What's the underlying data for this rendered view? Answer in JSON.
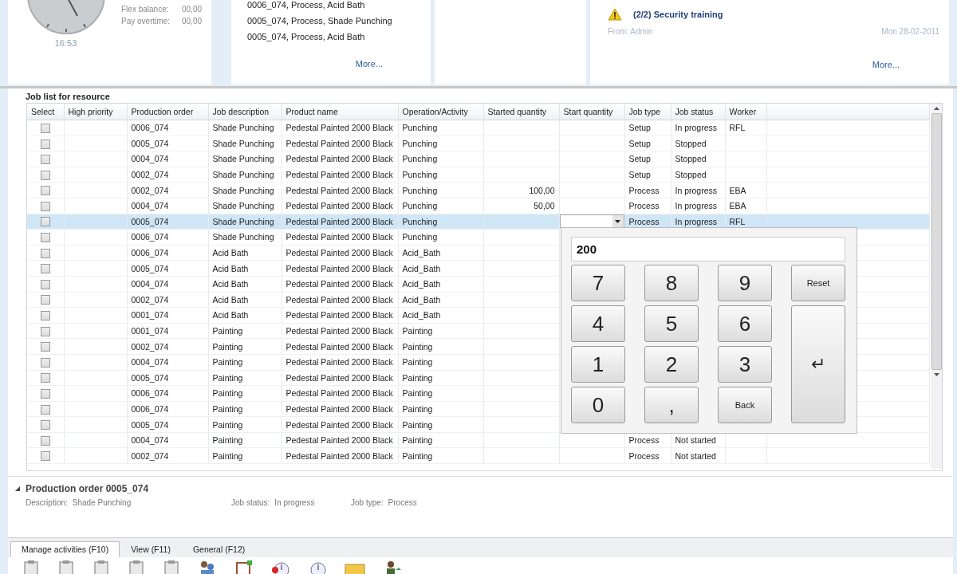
{
  "clock_panel": {
    "time": "16:53",
    "fields": [
      {
        "label": "Flex balance:",
        "value": "00,00"
      },
      {
        "label": "Pay overtime:",
        "value": "00,00"
      }
    ]
  },
  "recent_jobs": {
    "items": [
      "0006_074, Process, Acid Bath",
      "0005_074, Process, Shade Punching",
      "0005_074, Process, Acid Bath"
    ],
    "more": "More..."
  },
  "messages": {
    "items": [
      {
        "title": "(2/2) Security training",
        "from": "From: Admin",
        "date": "Mon 28-02-2011"
      }
    ],
    "more": "More..."
  },
  "job_list": {
    "title": "Job list for resource",
    "columns": [
      "Select",
      "High priority",
      "Production order",
      "Job description",
      "Product name",
      "Operation/Activity",
      "Started quantity",
      "Start quantity",
      "Job type",
      "Job status",
      "Worker"
    ],
    "rows": [
      {
        "selected": false,
        "checked": false,
        "editing": false,
        "order": "0006_074",
        "description": "Shade Punching",
        "product": "Pedestal Painted 2000 Black",
        "operation": "Punching",
        "job_type": "Setup",
        "job_status": "In progress",
        "worker": "RFL"
      },
      {
        "selected": false,
        "checked": false,
        "editing": false,
        "order": "0005_074",
        "description": "Shade Punching",
        "product": "Pedestal Painted 2000 Black",
        "operation": "Punching",
        "job_type": "Setup",
        "job_status": "Stopped"
      },
      {
        "selected": false,
        "checked": false,
        "editing": false,
        "order": "0004_074",
        "description": "Shade Punching",
        "product": "Pedestal Painted 2000 Black",
        "operation": "Punching",
        "job_type": "Setup",
        "job_status": "Stopped"
      },
      {
        "selected": false,
        "checked": false,
        "editing": false,
        "order": "0002_074",
        "description": "Shade Punching",
        "product": "Pedestal Painted 2000 Black",
        "operation": "Punching",
        "job_type": "Setup",
        "job_status": "Stopped"
      },
      {
        "selected": false,
        "checked": false,
        "editing": false,
        "order": "0002_074",
        "description": "Shade Punching",
        "product": "Pedestal Painted 2000 Black",
        "operation": "Punching",
        "started_qty": "100,00",
        "job_type": "Process",
        "job_status": "In progress",
        "worker": "EBA"
      },
      {
        "selected": false,
        "checked": false,
        "editing": false,
        "order": "0004_074",
        "description": "Shade Punching",
        "product": "Pedestal Painted 2000 Black",
        "operation": "Punching",
        "started_qty": "50,00",
        "job_type": "Process",
        "job_status": "In progress",
        "worker": "EBA"
      },
      {
        "selected": true,
        "checked": false,
        "editing": true,
        "order": "0005_074",
        "description": "Shade Punching",
        "product": "Pedestal Painted 2000 Black",
        "operation": "Punching",
        "job_type": "Process",
        "job_status": "In progress",
        "worker": "RFL"
      },
      {
        "selected": false,
        "checked": false,
        "editing": false,
        "order": "0006_074",
        "description": "Shade Punching",
        "product": "Pedestal Painted 2000 Black",
        "operation": "Punching"
      },
      {
        "selected": false,
        "checked": false,
        "editing": false,
        "order": "0006_074",
        "description": "Acid Bath",
        "product": "Pedestal Painted 2000 Black",
        "operation": "Acid_Bath"
      },
      {
        "selected": false,
        "checked": false,
        "editing": false,
        "order": "0005_074",
        "description": "Acid Bath",
        "product": "Pedestal Painted 2000 Black",
        "operation": "Acid_Bath"
      },
      {
        "selected": false,
        "checked": false,
        "editing": false,
        "order": "0004_074",
        "description": "Acid Bath",
        "product": "Pedestal Painted 2000 Black",
        "operation": "Acid_Bath"
      },
      {
        "selected": false,
        "checked": false,
        "editing": false,
        "order": "0002_074",
        "description": "Acid Bath",
        "product": "Pedestal Painted 2000 Black",
        "operation": "Acid_Bath"
      },
      {
        "selected": false,
        "checked": false,
        "editing": false,
        "order": "0001_074",
        "description": "Acid Bath",
        "product": "Pedestal Painted 2000 Black",
        "operation": "Acid_Bath"
      },
      {
        "selected": false,
        "checked": false,
        "editing": false,
        "order": "0001_074",
        "description": "Painting",
        "product": "Pedestal Painted 2000 Black",
        "operation": "Painting"
      },
      {
        "selected": false,
        "checked": false,
        "editing": false,
        "order": "0002_074",
        "description": "Painting",
        "product": "Pedestal Painted 2000 Black",
        "operation": "Painting"
      },
      {
        "selected": false,
        "checked": false,
        "editing": false,
        "order": "0004_074",
        "description": "Painting",
        "product": "Pedestal Painted 2000 Black",
        "operation": "Painting"
      },
      {
        "selected": false,
        "checked": false,
        "editing": false,
        "order": "0005_074",
        "description": "Painting",
        "product": "Pedestal Painted 2000 Black",
        "operation": "Painting"
      },
      {
        "selected": false,
        "checked": false,
        "editing": false,
        "order": "0006_074",
        "description": "Painting",
        "product": "Pedestal Painted 2000 Black",
        "operation": "Painting"
      },
      {
        "selected": false,
        "checked": false,
        "editing": false,
        "order": "0006_074",
        "description": "Painting",
        "product": "Pedestal Painted 2000 Black",
        "operation": "Painting"
      },
      {
        "selected": false,
        "checked": false,
        "editing": false,
        "order": "0005_074",
        "description": "Painting",
        "product": "Pedestal Painted 2000 Black",
        "operation": "Painting"
      },
      {
        "selected": false,
        "checked": false,
        "editing": false,
        "order": "0004_074",
        "description": "Painting",
        "product": "Pedestal Painted 2000 Black",
        "operation": "Painting",
        "job_type": "Process",
        "job_status": "Not started"
      },
      {
        "selected": false,
        "checked": false,
        "editing": false,
        "order": "0002_074",
        "description": "Painting",
        "product": "Pedestal Painted 2000 Black",
        "operation": "Painting",
        "job_type": "Process",
        "job_status": "Not started"
      }
    ]
  },
  "keypad": {
    "value": "200",
    "keys": [
      {
        "label": "7",
        "kind": "digit"
      },
      {
        "label": "8",
        "kind": "digit"
      },
      {
        "label": "9",
        "kind": "digit"
      },
      {
        "label": "Reset",
        "kind": "command"
      },
      {
        "label": "4",
        "kind": "digit"
      },
      {
        "label": "5",
        "kind": "digit"
      },
      {
        "label": "6",
        "kind": "digit"
      },
      {
        "label": "1",
        "kind": "digit"
      },
      {
        "label": "2",
        "kind": "digit"
      },
      {
        "label": "3",
        "kind": "digit"
      },
      {
        "label": "0",
        "kind": "digit"
      },
      {
        "label": ",",
        "kind": "digit"
      },
      {
        "label": "Back",
        "kind": "command"
      },
      {
        "label": "↵",
        "kind": "enter"
      }
    ]
  },
  "details": {
    "title": "Production order 0005_074",
    "expanded": true,
    "fields": [
      {
        "label": "Description:",
        "value": "Shade Punching"
      },
      {
        "label": "Job status:",
        "value": "In progress"
      },
      {
        "label": "Job type:",
        "value": "Process"
      }
    ]
  },
  "tabs": [
    {
      "label": "Manage activities (F10)",
      "selected": true
    },
    {
      "label": "View (F11)",
      "selected": false
    },
    {
      "label": "General (F12)",
      "selected": false
    }
  ]
}
